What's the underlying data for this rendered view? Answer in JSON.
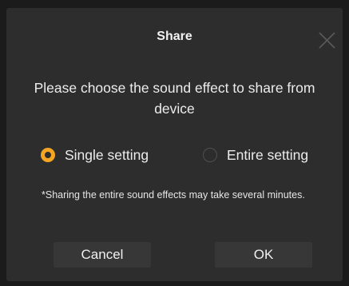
{
  "dialog": {
    "title": "Share",
    "close_icon": "close-icon",
    "prompt": "Please choose the sound effect to share from device",
    "options": [
      {
        "label": "Single setting",
        "selected": true
      },
      {
        "label": "Entire setting",
        "selected": false
      }
    ],
    "note": "*Sharing the entire sound effects may take several minutes.",
    "buttons": {
      "cancel": "Cancel",
      "ok": "OK"
    },
    "colors": {
      "background": "#1b1b1b",
      "dialog_bg": "#2d2d2d",
      "accent": "#f5a623",
      "button_bg": "#373737",
      "text": "#ececec"
    }
  }
}
